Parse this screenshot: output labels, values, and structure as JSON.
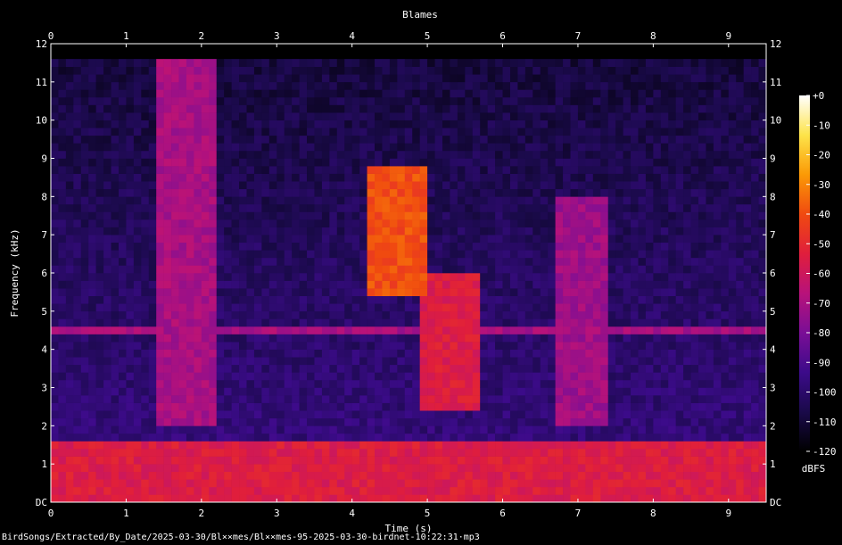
{
  "chart_data": {
    "type": "heatmap",
    "title": "Blames",
    "xlabel": "Time (s)",
    "ylabel": "Frequency (kHz)",
    "xlim": [
      0,
      9.5
    ],
    "ylim": [
      0,
      12
    ],
    "x_ticks": [
      "0",
      "1",
      "2",
      "3",
      "4",
      "5",
      "6",
      "7",
      "8",
      "9"
    ],
    "y_ticks": [
      "DC",
      "1",
      "2",
      "3",
      "4",
      "5",
      "6",
      "7",
      "8",
      "9",
      "10",
      "11",
      "12"
    ],
    "colorbar": {
      "label": "dBFS",
      "range": [
        -120,
        0
      ],
      "ticks": [
        "+0",
        "-10",
        "-20",
        "-30",
        "-40",
        "-50",
        "-60",
        "-70",
        "-80",
        "-90",
        "-100",
        "-110",
        "-120"
      ],
      "colormap": [
        "#000000",
        "#1a0a4a",
        "#3c0b8a",
        "#7a0e96",
        "#b8127a",
        "#e01e3c",
        "#f04a10",
        "#fb9a06",
        "#fde44a",
        "#ffffff"
      ]
    },
    "features": [
      {
        "name": "broadband noise floor",
        "t_start": 0.0,
        "t_end": 9.5,
        "f_min": 0,
        "f_max": 1.5,
        "level_dbfs": -55
      },
      {
        "name": "hum line",
        "t_start": 0.0,
        "t_end": 9.5,
        "f_min": 4.5,
        "f_max": 4.6,
        "level_dbfs": -70
      },
      {
        "name": "call burst 1",
        "t_start": 1.45,
        "t_end": 2.15,
        "f_min": 2.0,
        "f_max": 11.5,
        "level_dbfs": -70
      },
      {
        "name": "call burst 2",
        "t_start": 4.3,
        "t_end": 4.95,
        "f_min": 5.5,
        "f_max": 8.8,
        "level_dbfs": -40
      },
      {
        "name": "call burst 3",
        "t_start": 4.95,
        "t_end": 5.6,
        "f_min": 2.5,
        "f_max": 6.0,
        "level_dbfs": -55
      },
      {
        "name": "call burst 4",
        "t_start": 6.7,
        "t_end": 7.35,
        "f_min": 2.0,
        "f_max": 8.0,
        "level_dbfs": -72
      }
    ]
  },
  "footer": {
    "path": "BirdSongs/Extracted/By_Date/2025-03-30/Bl××mes/Bl××mes-95-2025-03-30-birdnet-10:22:31·mp3"
  }
}
